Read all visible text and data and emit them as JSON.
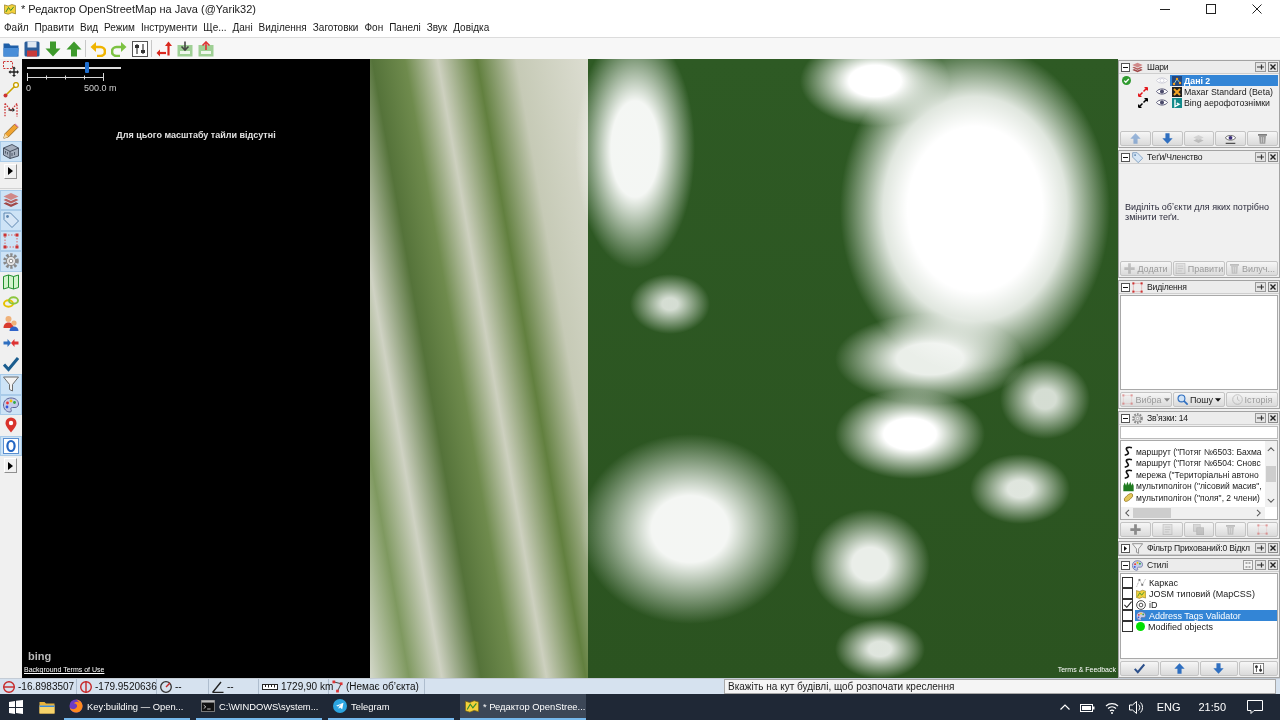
{
  "window": {
    "title": "* Редактор OpenStreetMap на Java (@Yarik32)"
  },
  "menu": [
    "Файл",
    "Правити",
    "Вид",
    "Режим",
    "Інструменти",
    "Ще...",
    "Дані",
    "Виділення",
    "Заготовки",
    "Фон",
    "Панелі",
    "Звук",
    "Довідка"
  ],
  "mode_bar": {
    "modes": [
      {
        "selected": false
      },
      {
        "selected": false
      },
      {
        "selected": false
      },
      {
        "selected": false
      },
      {
        "selected": true
      }
    ],
    "toggles": [
      {
        "on": true
      },
      {
        "on": true
      },
      {
        "on": true
      },
      {
        "on": true
      },
      {
        "on": false
      },
      {
        "on": false
      },
      {
        "on": false
      },
      {
        "on": false
      },
      {
        "on": false
      },
      {
        "on": true
      },
      {
        "on": true
      },
      {
        "on": false
      },
      {
        "on": true
      }
    ]
  },
  "map": {
    "zoom_slider": {
      "level": 0.64
    },
    "scale": {
      "start": "0",
      "end": "500.0 m"
    },
    "message": "Для цього масштабу тайли відсутні",
    "logo": "bing",
    "terms_link": "Background Terms of Use",
    "feedback_link": "Terms & Feedback"
  },
  "panels": [
    {
      "kind": "layers",
      "title": "Шари",
      "expanded": true,
      "layers": [
        {
          "name": "Дані 2",
          "kind": "data",
          "active": true,
          "visible": false,
          "selected": true
        },
        {
          "name": "Maxar Standard (Beta)",
          "kind": "maxar",
          "color": "#e3161b",
          "active": false,
          "visible": true,
          "selected": false
        },
        {
          "name": "Bing аерофотознімки",
          "kind": "bing",
          "color": "#000000",
          "active": false,
          "visible": true,
          "selected": false
        }
      ],
      "buttons": [
        {
          "disabled": true
        },
        {
          "disabled": false
        },
        {
          "disabled": true
        },
        {
          "disabled": false
        },
        {
          "disabled": false
        }
      ]
    },
    {
      "kind": "tags",
      "title": "Теґи/Членство",
      "expanded": true,
      "message": "Виділіть обʼєкти для яких потрібно змінити теґи.",
      "buttons": [
        {
          "label": "Додати",
          "disabled": true
        },
        {
          "label": "Правити",
          "disabled": true
        },
        {
          "label": "Вилуч...",
          "disabled": true
        }
      ]
    },
    {
      "kind": "selection",
      "title": "Виділення",
      "expanded": true,
      "buttons": [
        {
          "label": "Вибра",
          "disabled": true
        },
        {
          "label": "Пошу",
          "disabled": false
        },
        {
          "label": "Історія",
          "disabled": true
        }
      ]
    },
    {
      "kind": "relations",
      "title": "Звʼязки: 14",
      "expanded": true,
      "relations": [
        {
          "kind": "route",
          "label": "маршрут (\"Потяг №6503: Бахма"
        },
        {
          "kind": "route",
          "label": "маршрут (\"Потяг №6504: Сновс"
        },
        {
          "kind": "network",
          "label": "мережа (\"Територіальні автоно"
        },
        {
          "kind": "forest",
          "label": "мультиполігон (\"лісовий масив\","
        },
        {
          "kind": "fields",
          "label": "мультиполігон (\"поля\", 2 члени)"
        }
      ],
      "buttons": [
        {
          "disabled": false
        },
        {
          "disabled": true
        },
        {
          "disabled": true
        },
        {
          "disabled": true
        },
        {
          "disabled": true
        }
      ]
    },
    {
      "kind": "filter",
      "title": "Фільтр Прихований:0 Відкл",
      "expanded": false
    },
    {
      "kind": "styles",
      "title": "Стилі",
      "expanded": true,
      "styles": [
        {
          "label": "Каркас",
          "kind": "wire",
          "checked": false,
          "selected": false
        },
        {
          "label": "JOSM типовий (MapCSS)",
          "kind": "map",
          "checked": false,
          "selected": false
        },
        {
          "label": "iD",
          "kind": "target",
          "checked": true,
          "selected": false
        },
        {
          "label": "Address Tags Validator",
          "kind": "palette",
          "checked": false,
          "selected": true
        },
        {
          "label": "Modified objects",
          "kind": "dot",
          "color": "#00e000",
          "checked": false,
          "selected": false
        }
      ]
    }
  ],
  "status_bar": {
    "latitude": "-16.8983507",
    "longitude": "-179.9520636",
    "heading": "--",
    "angle": "--",
    "distance": "1729,90 km",
    "object": "(Немає обʼєкта)",
    "help": "Вкажіть на кут будівлі, щоб розпочати креслення"
  },
  "taskbar": {
    "apps": [
      {
        "kind": "browser",
        "label": "Key:building — Open...",
        "selected": false
      },
      {
        "kind": "terminal",
        "label": "C:\\WINDOWS\\system...",
        "selected": false
      },
      {
        "kind": "messenger",
        "label": "Telegram",
        "selected": false
      },
      {
        "kind": "editor",
        "label": "* Редактор OpenStree...",
        "selected": true
      }
    ],
    "language": "ENG",
    "time": "21:50"
  }
}
